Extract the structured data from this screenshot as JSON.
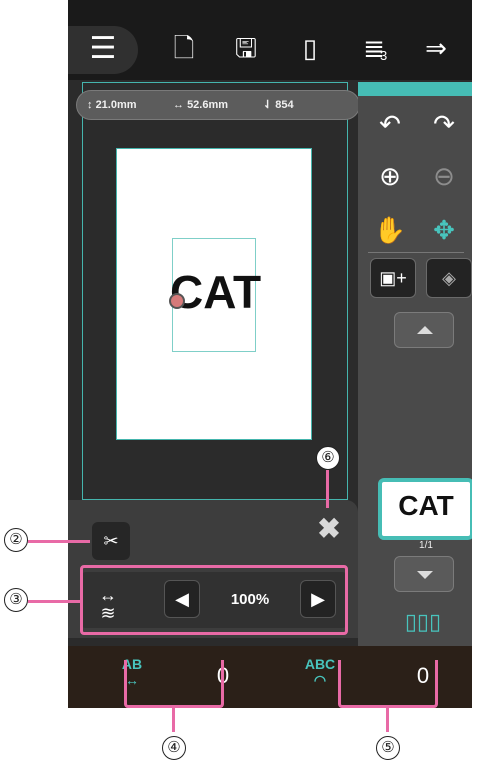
{
  "toolbar": {
    "menu_icon": "hamburger-icon",
    "icons": [
      "new-file-icon",
      "save-icon",
      "hoop-icon",
      "thread-icon",
      "next-icon"
    ],
    "thread_count": "3"
  },
  "measurements": {
    "height": "21.0mm",
    "width": "52.6mm",
    "stitches": "854"
  },
  "design": {
    "text": "CAT"
  },
  "side_panel": {
    "page": "1/1"
  },
  "edit": {
    "size_value": "100%"
  },
  "bottom": {
    "spacing_value": "0",
    "arc_value": "0",
    "spacing_icon_label": "AB",
    "arc_icon_label": "ABC"
  },
  "callouts": {
    "c2": "②",
    "c3": "③",
    "c4": "④",
    "c5": "⑤",
    "c6": "⑥"
  },
  "colors": {
    "accent": "#46bdb5",
    "highlight": "#e86aa6",
    "panel": "#4a4a4a",
    "bottom_bar": "#2b2018"
  }
}
